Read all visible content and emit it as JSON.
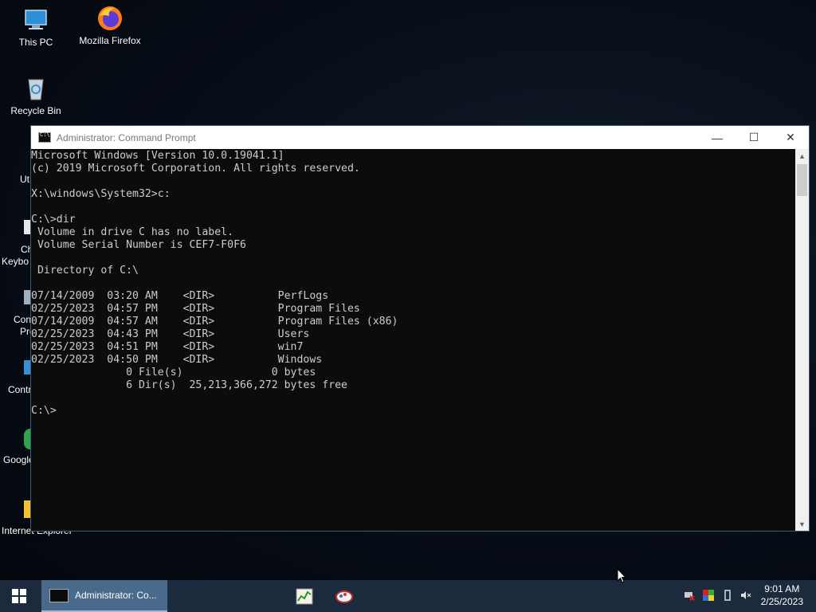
{
  "desktop": {
    "icons": [
      {
        "label": "This PC"
      },
      {
        "label": "Mozilla Firefox"
      },
      {
        "label": "Recycle Bin"
      }
    ],
    "partial_labels": [
      "Ut",
      "Ch",
      "Keybo",
      "Con",
      "Pro",
      "Contr",
      "Google",
      "Internet Explorer"
    ]
  },
  "window": {
    "title": "Administrator: Command Prompt",
    "controls": {
      "minimize": "—",
      "maximize": "☐",
      "close": "✕"
    }
  },
  "console": {
    "lines": [
      "Microsoft Windows [Version 10.0.19041.1]",
      "(c) 2019 Microsoft Corporation. All rights reserved.",
      "",
      "X:\\windows\\System32>c:",
      "",
      "C:\\>dir",
      " Volume in drive C has no label.",
      " Volume Serial Number is CEF7-F0F6",
      "",
      " Directory of C:\\",
      "",
      "07/14/2009  03:20 AM    <DIR>          PerfLogs",
      "02/25/2023  04:57 PM    <DIR>          Program Files",
      "07/14/2009  04:57 AM    <DIR>          Program Files (x86)",
      "02/25/2023  04:43 PM    <DIR>          Users",
      "02/25/2023  04:51 PM    <DIR>          win7",
      "02/25/2023  04:50 PM    <DIR>          Windows",
      "               0 File(s)              0 bytes",
      "               6 Dir(s)  25,213,366,272 bytes free",
      "",
      "C:\\>"
    ]
  },
  "taskbar": {
    "active_task": "Administrator: Co...",
    "clock": {
      "time": "9:01 AM",
      "date": "2/25/2023"
    }
  },
  "colors": {
    "console_bg": "#0c0c0c",
    "console_text": "#cccccc",
    "taskbar_bg": "#1b2a3c",
    "active_task_bg": "#4a6a8c"
  }
}
